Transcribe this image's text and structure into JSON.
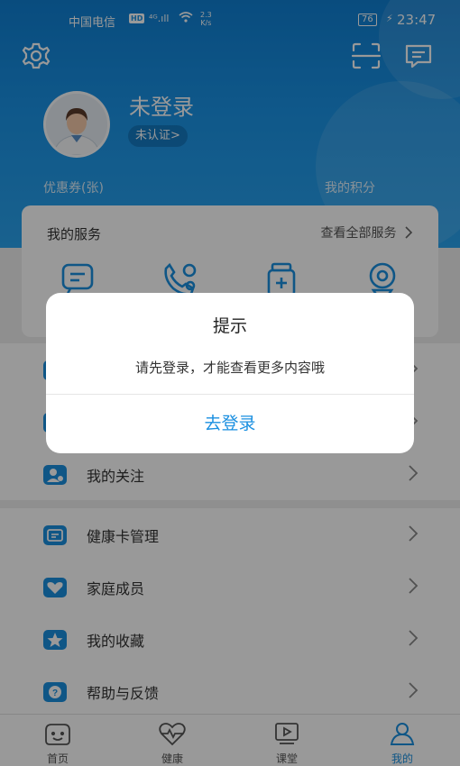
{
  "status_bar": {
    "carrier": "中国电信",
    "hd": "HD",
    "signal": "⁴ᴳ.ıll",
    "speed_value": "2.3",
    "speed_unit": "K/s",
    "battery": "76",
    "time": "23:47"
  },
  "profile": {
    "name": "未登录",
    "verify": "未认证>"
  },
  "stats": {
    "coupon_label": "优惠券(张)",
    "points_label": "我的积分"
  },
  "services": {
    "title": "我的服务",
    "view_all": "查看全部服务",
    "items": [
      {
        "icon": "consult-icon"
      },
      {
        "icon": "phone-doctor-icon"
      },
      {
        "icon": "medicine-icon"
      },
      {
        "icon": "camera-icon"
      }
    ]
  },
  "menu_group_1": [
    {
      "label": "",
      "icon": "order-icon"
    },
    {
      "label": "",
      "icon": "prescription-icon"
    },
    {
      "label": "我的关注",
      "icon": "follow-icon"
    }
  ],
  "menu_group_2": [
    {
      "label": "健康卡管理",
      "icon": "health-card-icon"
    },
    {
      "label": "家庭成员",
      "icon": "family-icon"
    },
    {
      "label": "我的收藏",
      "icon": "star-icon"
    },
    {
      "label": "帮助与反馈",
      "icon": "help-icon"
    }
  ],
  "tabs": [
    {
      "label": "首页",
      "icon": "home-face-icon",
      "active": false
    },
    {
      "label": "健康",
      "icon": "heart-pulse-icon",
      "active": false
    },
    {
      "label": "课堂",
      "icon": "video-icon",
      "active": false
    },
    {
      "label": "我的",
      "icon": "person-icon",
      "active": true
    }
  ],
  "dialog": {
    "title": "提示",
    "message": "请先登录，才能查看更多内容哦",
    "button": "去登录"
  },
  "colors": {
    "brand": "#1a8fe0",
    "overlay": "rgba(0,0,0,0.40)"
  }
}
